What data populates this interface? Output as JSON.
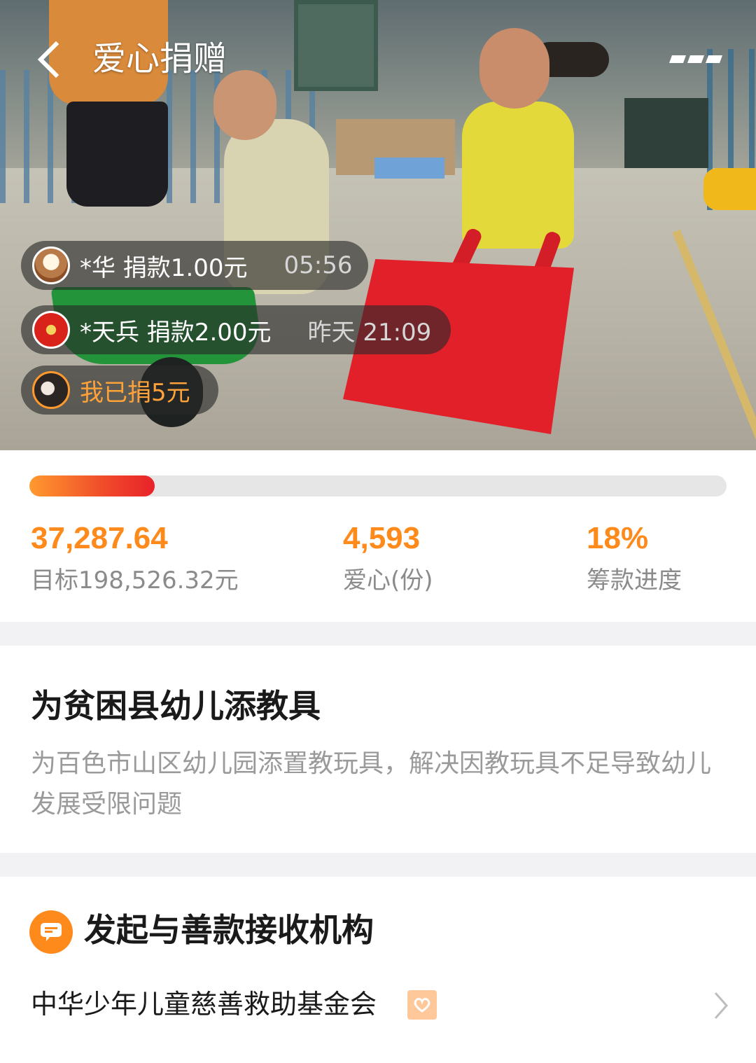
{
  "header": {
    "title": "爱心捐赠",
    "back_icon": "chevron-left-icon",
    "more_icon": "more-icon"
  },
  "donations": [
    {
      "name": "*华 捐款1.00元",
      "time": "05:56"
    },
    {
      "name": "*天兵 捐款2.00元",
      "time": "昨天 21:09"
    }
  ],
  "my_donation": {
    "label": "我已捐5元"
  },
  "progress": {
    "fraction": 0.18,
    "raised": "37,287.64",
    "target_label": "目标198,526.32元",
    "hearts": "4,593",
    "hearts_label": "爱心(份)",
    "percent": "18%",
    "percent_label": "筹款进度"
  },
  "project": {
    "title": "为贫困县幼儿添教具",
    "description": "为百色市山区幼儿园添置教玩具，解决因教玩具不足导致幼儿发展受限问题"
  },
  "organization": {
    "section_title": "发起与善款接收机构",
    "name": "中华少年儿童慈善救助基金会"
  },
  "colors": {
    "accent": "#ff8a1c",
    "progress_end": "#e8222a",
    "pill_bg": "rgba(40,40,40,0.62)"
  }
}
